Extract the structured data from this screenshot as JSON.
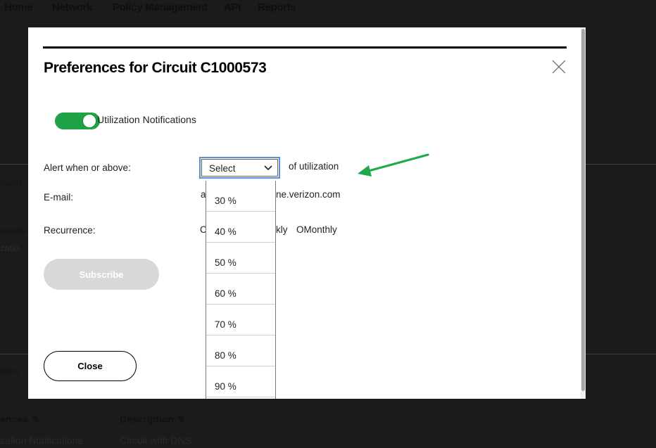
{
  "background": {
    "nav": [
      "Home",
      "Network",
      "Policy Management",
      "API",
      "Reports"
    ],
    "fragments": [
      "ment",
      "ences",
      "zatio",
      "men"
    ],
    "table": {
      "headers": [
        "ences",
        "Description"
      ],
      "row": [
        "zation Notifications",
        "Circuit with DNS"
      ]
    }
  },
  "modal": {
    "title": "Preferences for Circuit C1000573",
    "toggle": {
      "label": "Utilization Notifications",
      "on": true,
      "color": "#1fa245"
    },
    "alert": {
      "label": "Alert when or above:",
      "select_value": "Select",
      "suffix": "of utilization"
    },
    "email": {
      "label": "E-mail:",
      "value_left": "a",
      "value_right": "ne.verizon.com"
    },
    "recurrence": {
      "label": "Recurrence:",
      "opt_left": "C",
      "opt_mid": "kly",
      "opt_monthly": "OMonthly"
    },
    "subscribe_label": "Subscribe",
    "close_label": "Close"
  },
  "dropdown": {
    "options": [
      "30 %",
      "40 %",
      "50 %",
      "60 %",
      "70 %",
      "80 %",
      "90 %"
    ]
  },
  "annotation": {
    "arrow_color": "#1faa4a",
    "icon": "arrow-icon"
  }
}
